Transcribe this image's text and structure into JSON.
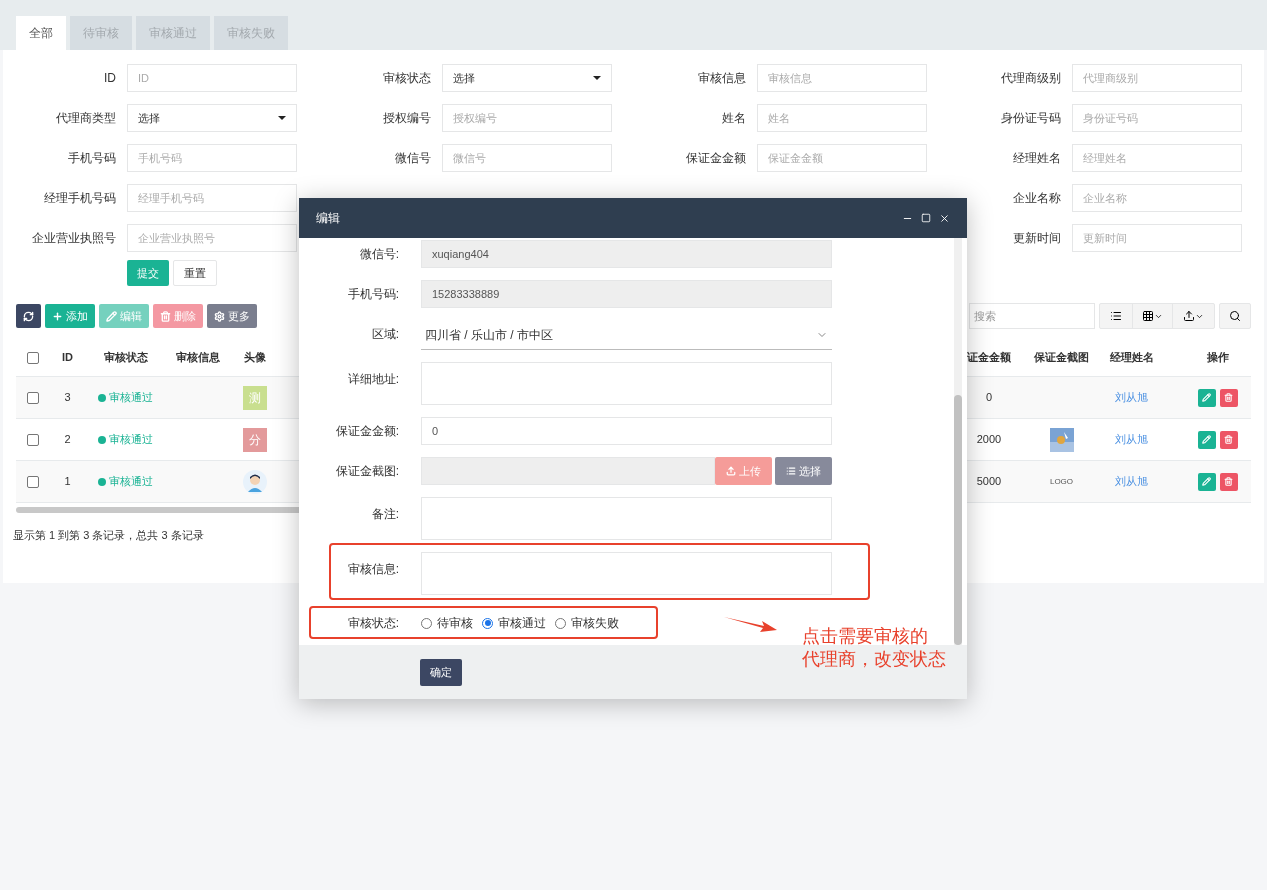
{
  "tabs": [
    {
      "label": "全部",
      "selected": true
    },
    {
      "label": "待审核",
      "selected": false
    },
    {
      "label": "审核通过",
      "selected": false
    },
    {
      "label": "审核失败",
      "selected": false
    }
  ],
  "filter_columns": [
    [
      {
        "label": "ID",
        "kind": "text",
        "placeholder": "ID"
      },
      {
        "label": "代理商类型",
        "kind": "select",
        "value": "选择"
      },
      {
        "label": "手机号码",
        "kind": "text",
        "placeholder": "手机号码"
      },
      {
        "label": "经理手机号码",
        "kind": "text",
        "placeholder": "经理手机号码"
      },
      {
        "label": "企业营业执照号",
        "kind": "text",
        "placeholder": "企业营业执照号"
      }
    ],
    [
      {
        "label": "审核状态",
        "kind": "select",
        "value": "选择"
      },
      {
        "label": "授权编号",
        "kind": "text",
        "placeholder": "授权编号"
      },
      {
        "label": "微信号",
        "kind": "text",
        "placeholder": "微信号"
      }
    ],
    [
      {
        "label": "审核信息",
        "kind": "text",
        "placeholder": "审核信息"
      },
      {
        "label": "姓名",
        "kind": "text",
        "placeholder": "姓名"
      },
      {
        "label": "保证金金额",
        "kind": "text",
        "placeholder": "保证金金额"
      }
    ],
    [
      {
        "label": "代理商级别",
        "kind": "text",
        "placeholder": "代理商级别"
      },
      {
        "label": "身份证号码",
        "kind": "text",
        "placeholder": "身份证号码"
      },
      {
        "label": "经理姓名",
        "kind": "text",
        "placeholder": "经理姓名"
      },
      {
        "label": "企业名称",
        "kind": "text",
        "placeholder": "企业名称"
      },
      {
        "label": "更新时间",
        "kind": "text",
        "placeholder": "更新时间"
      }
    ]
  ],
  "filter_buttons": [
    {
      "label": "提交",
      "kind": "primary"
    },
    {
      "label": "重置",
      "kind": "default"
    }
  ],
  "toolbar": [
    {
      "kind": "refresh",
      "disabled": false
    },
    {
      "kind": "add",
      "label": "添加",
      "disabled": false
    },
    {
      "kind": "edit",
      "label": "编辑",
      "disabled": true
    },
    {
      "kind": "delete",
      "label": "删除",
      "disabled": true
    },
    {
      "kind": "more",
      "label": "更多",
      "disabled": false
    }
  ],
  "search": {
    "placeholder": "搜索"
  },
  "table": {
    "header_checked": false,
    "columns_left": [
      "ID",
      "审核状态",
      "审核信息",
      "头像"
    ],
    "columns_right": [
      "证金金额",
      "保证金截图",
      "经理姓名",
      "操作"
    ],
    "rows": [
      {
        "checked": false,
        "id": "3",
        "status": "审核通过",
        "avatar": {
          "kind": "text",
          "text": "测",
          "color": "#c9df8f"
        },
        "deposit": "0",
        "screenshot": {
          "kind": "none"
        },
        "manager": "刘从旭"
      },
      {
        "checked": false,
        "id": "2",
        "status": "审核通过",
        "avatar": {
          "kind": "text",
          "text": "分",
          "color": "#e39a9b"
        },
        "deposit": "2000",
        "manager": "刘从旭"
      },
      {
        "checked": false,
        "id": "1",
        "status": "审核通过",
        "avatar": {
          "kind": "figure"
        },
        "deposit": "5000",
        "screenshot": {
          "kind": "text",
          "text": "LOGO"
        },
        "manager": "刘从旭"
      }
    ]
  },
  "pagination_info": "显示第 1 到第 3 条记录，总共 3 条记录",
  "modal": {
    "title": "编辑",
    "fields": [
      {
        "label": "微信号:",
        "kind": "readonly",
        "value": "xuqiang404"
      },
      {
        "label": "手机号码:",
        "kind": "readonly",
        "value": "15283338889"
      },
      {
        "label": "区域:",
        "kind": "cascader",
        "value": "四川省 / 乐山市 / 市中区"
      },
      {
        "label": "详细地址:",
        "kind": "textarea"
      },
      {
        "label": "保证金金额:",
        "kind": "text",
        "value": "0"
      },
      {
        "label": "保证金截图:",
        "kind": "upload",
        "buttons": [
          "上传",
          "选择"
        ]
      },
      {
        "label": "备注:",
        "kind": "textarea"
      },
      {
        "label": "审核信息:",
        "kind": "textarea",
        "highlighted": true
      }
    ],
    "status": {
      "label": "审核状态:",
      "highlighted": true,
      "options": [
        {
          "label": "待审核",
          "selected": false
        },
        {
          "label": "审核通过",
          "selected": true
        },
        {
          "label": "审核失败",
          "selected": false
        }
      ]
    },
    "confirm": "确定"
  },
  "annotation": [
    "点击需要审核的",
    "代理商，改变状态"
  ]
}
